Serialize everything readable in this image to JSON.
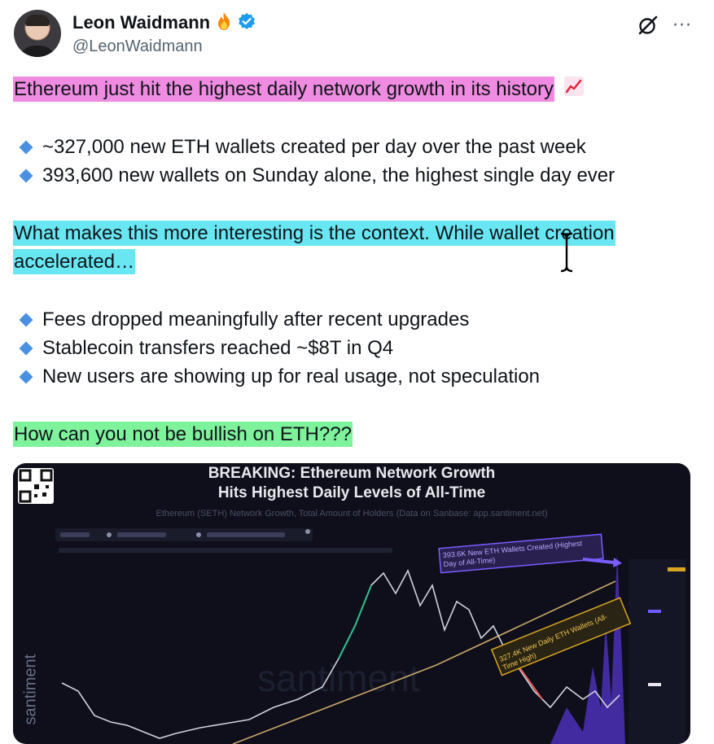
{
  "author": {
    "name": "Leon Waidmann",
    "handle": "@LeonWaidmann",
    "name_emoji": "fire-emoji",
    "verified_icon": "verified-badge-icon"
  },
  "actions": {
    "grok_icon": "grok-icon",
    "more_label": "···"
  },
  "post": {
    "headline": "Ethereum just hit the highest daily network growth in its history",
    "headline_emoji": "chart-increasing-icon",
    "bullets_1": [
      "~327,000 new ETH wallets created per day over the past week",
      "393,600 new wallets on Sunday alone, the highest single day ever"
    ],
    "context_line1": "What makes this more interesting is the context. While wallet creation",
    "context_line2": "accelerated…",
    "bullets_2": [
      "Fees dropped meaningfully after recent upgrades",
      "Stablecoin transfers reached ~$8T in Q4",
      "New users are showing up for real usage, not speculation"
    ],
    "closing": "How can you not be bullish on ETH???"
  },
  "colors": {
    "highlight_pink": "#ef8be0",
    "highlight_cyan": "#68e6f2",
    "highlight_green": "#7ff29c",
    "bullet_blue": "#4a90e2",
    "chart_bg": "#0e0f1a",
    "annotation_purple": "#7b5cff",
    "annotation_gold": "#d9a521"
  },
  "chart_image": {
    "title_line1": "BREAKING: Ethereum Network Growth",
    "title_line2": "Hits Highest Daily Levels of All-Time",
    "subtitle": "Ethereum (SETH) Network Growth, Total Amount of Holders (Data on Sanbase: app.santiment.net)",
    "watermark": "santiment",
    "side_brand": "santiment",
    "annotation_top": "393.6K New ETH Wallets Created (Highest Day of All-Time)",
    "annotation_mid": "327.4K New Daily ETH Wallets (All-Time High)"
  }
}
